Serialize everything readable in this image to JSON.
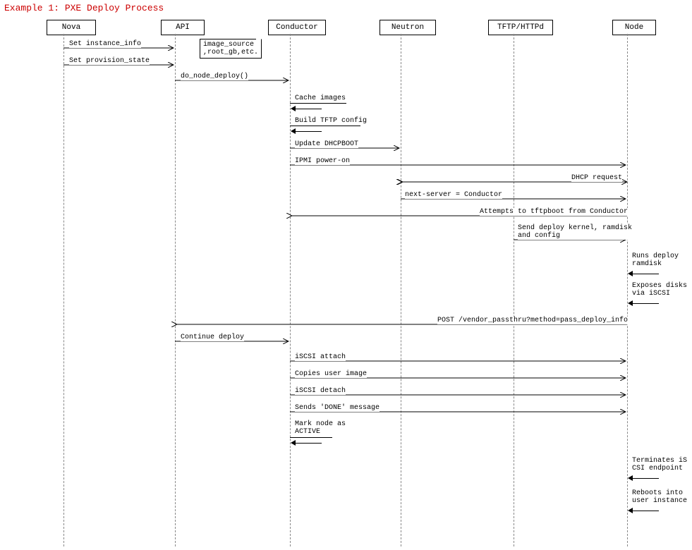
{
  "title": "Example 1: PXE Deploy Process",
  "participants": {
    "nova": "Nova",
    "api": "API",
    "conductor": "Conductor",
    "neutron": "Neutron",
    "tftp": "TFTP/HTTPd",
    "node": "Node"
  },
  "note": {
    "line1": "image_source",
    "line2": ",root_gb,etc."
  },
  "messages": {
    "set_instance_info": "Set instance_info",
    "set_provision_state": "Set provision_state",
    "do_node_deploy": "do_node_deploy()",
    "cache_images": "Cache images",
    "build_tftp_config": "Build TFTP config",
    "update_dhcpboot": "Update DHCPBOOT",
    "ipmi_power_on": "IPMI power-on",
    "dhcp_request": "DHCP request",
    "next_server": "next-server = Conductor",
    "attempts_tftp": "Attempts to tftpboot from Conductor",
    "send_deploy_kernel": "Send deploy kernel, ramdisk\nand config",
    "runs_deploy_ramdisk": "Runs deploy\nramdisk",
    "exposes_disks": "Exposes disks\nvia iSCSI",
    "post_vendor": "POST /vendor_passthru?method=pass_deploy_info",
    "continue_deploy": "Continue deploy",
    "iscsi_attach": "iSCSI attach",
    "copies_user_image": "Copies user image",
    "iscsi_detach": "iSCSI detach",
    "sends_done": "Sends 'DONE' message",
    "mark_node_active": "Mark node as\nACTIVE",
    "terminates_iscsi": "Terminates iS\nCSI endpoint",
    "reboots_into": "Reboots into\nuser instance"
  },
  "chart_data": {
    "type": "sequence_diagram",
    "title": "Example 1: PXE Deploy Process",
    "participants": [
      "Nova",
      "API",
      "Conductor",
      "Neutron",
      "TFTP/HTTPd",
      "Node"
    ],
    "events": [
      {
        "from": "Nova",
        "to": "API",
        "label": "Set instance_info",
        "note_right_of_to": "image_source, root_gb, etc."
      },
      {
        "from": "Nova",
        "to": "API",
        "label": "Set provision_state"
      },
      {
        "from": "API",
        "to": "Conductor",
        "label": "do_node_deploy()"
      },
      {
        "from": "Conductor",
        "to": "Conductor",
        "label": "Cache images"
      },
      {
        "from": "Conductor",
        "to": "Conductor",
        "label": "Build TFTP config"
      },
      {
        "from": "Conductor",
        "to": "Neutron",
        "label": "Update DHCPBOOT"
      },
      {
        "from": "Conductor",
        "to": "Node",
        "label": "IPMI power-on"
      },
      {
        "from": "Node",
        "to": "Neutron",
        "label": "DHCP request"
      },
      {
        "from": "Neutron",
        "to": "Node",
        "label": "next-server = Conductor"
      },
      {
        "from": "Node",
        "to": "Conductor",
        "label": "Attempts to tftpboot from Conductor"
      },
      {
        "from": "TFTP/HTTPd",
        "to": "Node",
        "label": "Send deploy kernel, ramdisk and config"
      },
      {
        "from": "Node",
        "to": "Node",
        "label": "Runs deploy ramdisk"
      },
      {
        "from": "Node",
        "to": "Node",
        "label": "Exposes disks via iSCSI"
      },
      {
        "from": "Node",
        "to": "API",
        "label": "POST /vendor_passthru?method=pass_deploy_info"
      },
      {
        "from": "API",
        "to": "Conductor",
        "label": "Continue deploy"
      },
      {
        "from": "Conductor",
        "to": "Node",
        "label": "iSCSI attach"
      },
      {
        "from": "Conductor",
        "to": "Node",
        "label": "Copies user image"
      },
      {
        "from": "Conductor",
        "to": "Node",
        "label": "iSCSI detach"
      },
      {
        "from": "Conductor",
        "to": "Node",
        "label": "Sends 'DONE' message"
      },
      {
        "from": "Conductor",
        "to": "Conductor",
        "label": "Mark node as ACTIVE"
      },
      {
        "from": "Node",
        "to": "Node",
        "label": "Terminates iSCSI endpoint"
      },
      {
        "from": "Node",
        "to": "Node",
        "label": "Reboots into user instance"
      }
    ]
  }
}
